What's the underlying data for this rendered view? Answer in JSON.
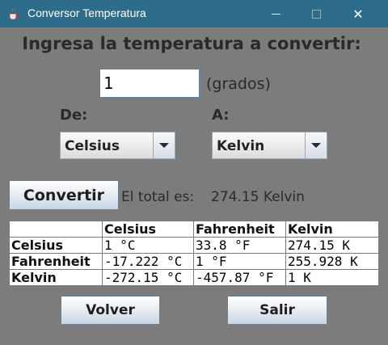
{
  "window": {
    "title": "Conversor Temperatura",
    "close_symbol": "✕"
  },
  "form": {
    "heading": "Ingresa la temperatura a convertir:",
    "amount_value": "1",
    "unit_label": "(grados)",
    "from_label": "De:",
    "to_label": "A:",
    "from_selected": "Celsius",
    "to_selected": "Kelvin",
    "convert_label": "Convertir",
    "total_label": "El total es:",
    "total_value": "274.15 Kelvin"
  },
  "table": {
    "columns": [
      "",
      "Celsius",
      "Fahrenheit",
      "Kelvin"
    ],
    "rows": [
      [
        "Celsius",
        "1 °C",
        "33.8 °F",
        "274.15 K"
      ],
      [
        "Fahrenheit",
        "-17.222 °C",
        "1 °F",
        "255.928 K"
      ],
      [
        "Kelvin",
        "-272.15 °C",
        "-457.87 °F",
        "1 K"
      ]
    ]
  },
  "footer": {
    "back_label": "Volver",
    "exit_label": "Salir"
  },
  "colors": {
    "titlebar": "#2d6d8b",
    "background": "#7c7c7c"
  },
  "icons": {
    "app": "java-cup-icon",
    "minimize": "minimize-icon",
    "maximize": "maximize-icon",
    "close": "close-icon",
    "dropdown": "chevron-down-icon"
  }
}
